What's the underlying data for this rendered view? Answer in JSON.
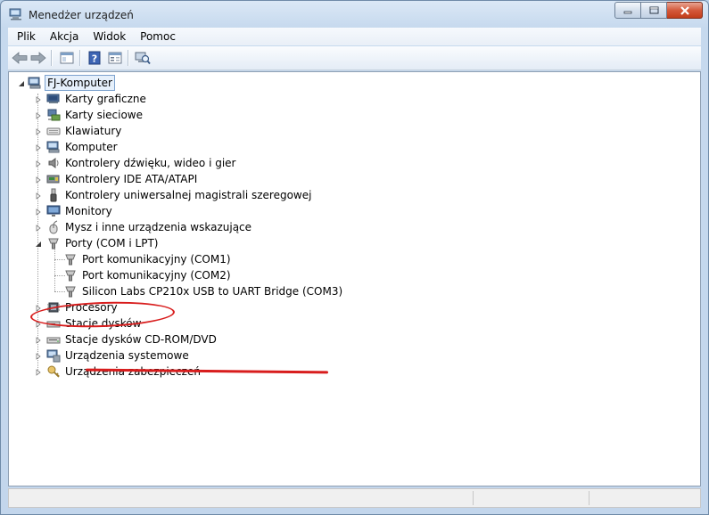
{
  "window": {
    "title": "Menedżer urządzeń"
  },
  "menu": [
    "Plik",
    "Akcja",
    "Widok",
    "Pomoc"
  ],
  "toolbar": {
    "buttons": [
      "back-icon",
      "forward-icon",
      "show-hide-console-tree-icon",
      "help-icon",
      "properties-icon",
      "scan-hardware-icon"
    ]
  },
  "tree": {
    "root": "FJ-Komputer",
    "categories": [
      {
        "label": "Karty graficzne",
        "icon": "display-adapter-icon"
      },
      {
        "label": "Karty sieciowe",
        "icon": "network-adapter-icon"
      },
      {
        "label": "Klawiatury",
        "icon": "keyboard-icon"
      },
      {
        "label": "Komputer",
        "icon": "computer-icon"
      },
      {
        "label": "Kontrolery dźwięku, wideo i gier",
        "icon": "speaker-icon"
      },
      {
        "label": "Kontrolery IDE ATA/ATAPI",
        "icon": "ide-controller-icon"
      },
      {
        "label": "Kontrolery uniwersalnej magistrali szeregowej",
        "icon": "usb-icon"
      },
      {
        "label": "Monitory",
        "icon": "monitor-icon"
      },
      {
        "label": "Mysz i inne urządzenia wskazujące",
        "icon": "mouse-icon"
      },
      {
        "label": "Porty (COM i LPT)",
        "icon": "port-icon",
        "expanded": true,
        "children": [
          {
            "label": "Port komunikacyjny (COM1)",
            "icon": "port-icon"
          },
          {
            "label": "Port komunikacyjny (COM2)",
            "icon": "port-icon"
          },
          {
            "label": "Silicon Labs CP210x USB to UART Bridge (COM3)",
            "icon": "port-icon"
          }
        ]
      },
      {
        "label": "Procesory",
        "icon": "processor-icon"
      },
      {
        "label": "Stacje dysków",
        "icon": "disk-drive-icon"
      },
      {
        "label": "Stacje dysków CD-ROM/DVD",
        "icon": "cdrom-icon"
      },
      {
        "label": "Urządzenia systemowe",
        "icon": "system-devices-icon"
      },
      {
        "label": "Urządzenia zabezpieczeń",
        "icon": "security-devices-icon"
      }
    ]
  },
  "colors": {
    "annotation": "#d81d1d",
    "selection_border": "#7da2ce"
  }
}
